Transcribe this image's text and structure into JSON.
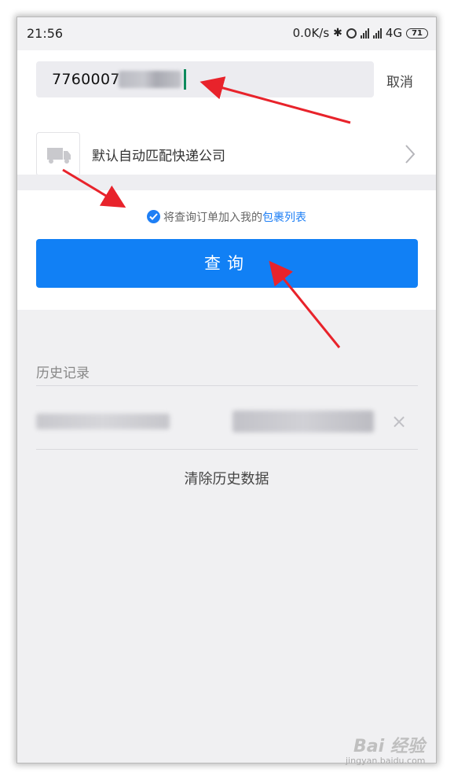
{
  "status_bar": {
    "time": "21:56",
    "network_speed": "0.0K/s",
    "network_type": "4G",
    "battery": "71"
  },
  "search": {
    "value": "7760007"
  },
  "cancel_label": "取消",
  "company": {
    "name": "默认自动匹配快递公司"
  },
  "package_option": {
    "text": "将查询订单加入我的",
    "link": "包裹列表",
    "checked": true
  },
  "query_button": {
    "label": "查询"
  },
  "history": {
    "title": "历史记录",
    "clear_label": "清除历史数据"
  },
  "watermark": {
    "brand": "Bai 经验",
    "url": "jingyan.baidu.com"
  },
  "colors": {
    "accent": "#1180f5",
    "arrow": "#e8232b"
  }
}
